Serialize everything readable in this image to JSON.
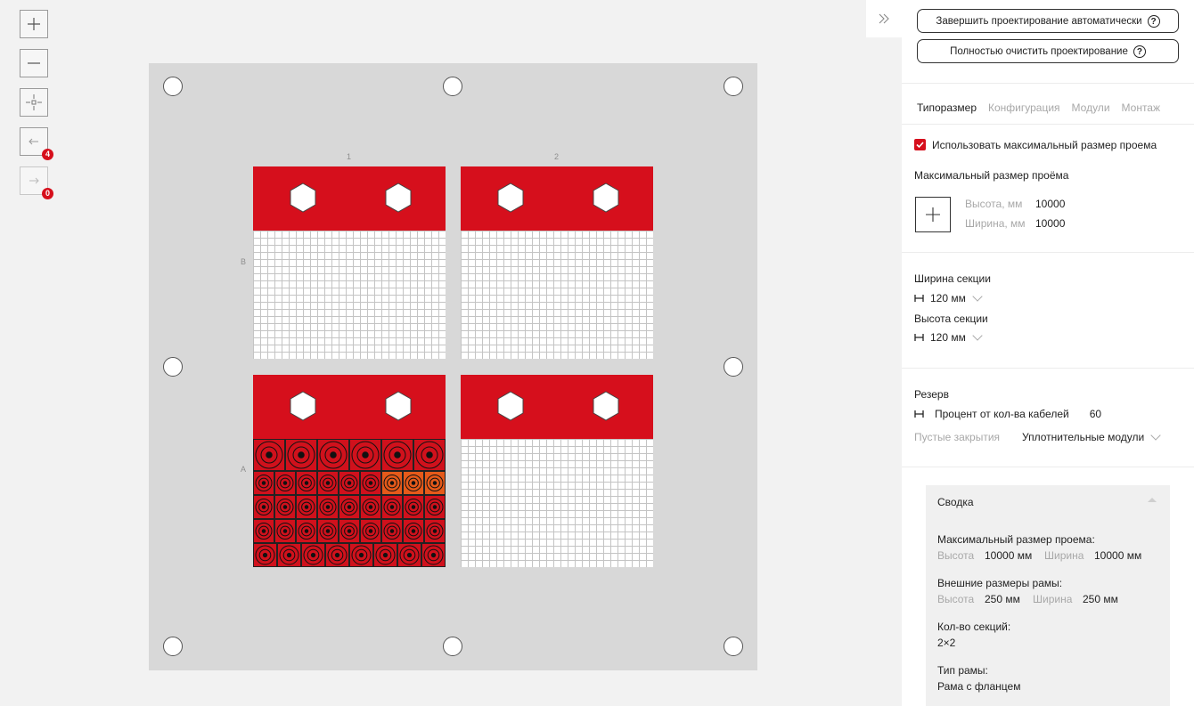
{
  "toolbar": {
    "undo_count": "4",
    "redo_count": "0"
  },
  "canvas": {
    "columns": [
      "1",
      "2"
    ],
    "rows": [
      "B",
      "A"
    ]
  },
  "sidebar": {
    "complete_auto_label": "Завершить проектирование автоматически",
    "clear_all_label": "Полностью очистить проектирование",
    "help_symbol": "?",
    "tabs": [
      "Типоразмер",
      "Конфигурация",
      "Модули",
      "Монтаж"
    ],
    "active_tab": "Типоразмер",
    "use_max_size_label": "Использовать максимальный размер проема",
    "use_max_size_checked": true,
    "max_opening_title": "Максимальный размер проёма",
    "height_label": "Высота, мм",
    "height_value": "10000",
    "width_label": "Ширина, мм",
    "width_value": "10000",
    "section_width_title": "Ширина секции",
    "section_width_value": "120 мм",
    "section_height_title": "Высота секции",
    "section_height_value": "120 мм",
    "reserve_title": "Резерв",
    "reserve_label": "Процент от кол-ва кабелей",
    "reserve_value": "60",
    "empty_closures_label": "Пустые закрытия",
    "empty_closures_value": "Уплотнительные модули"
  },
  "summary": {
    "title": "Сводка",
    "max_opening_label": "Максимальный размер проема:",
    "height_key": "Высота",
    "max_height_value": "10000 мм",
    "width_key": "Ширина",
    "max_width_value": "10000 мм",
    "frame_outer_label": "Внешние размеры рамы:",
    "frame_height_value": "250 мм",
    "frame_width_value": "250 мм",
    "section_count_label": "Кол-во секций:",
    "section_count_value": "2×2",
    "frame_type_label": "Тип рамы:",
    "frame_type_value": "Рама с фланцем"
  },
  "colors": {
    "accent": "#d60f1c",
    "module_fill": "#d0111c",
    "module_selected": "#e65a1a",
    "canvas_bg": "#d8d8d8"
  },
  "icons": [
    "zoom-in-icon",
    "zoom-out-icon",
    "center-icon",
    "undo-icon",
    "redo-icon",
    "collapse-panel-icon",
    "help-icon",
    "checkmark-icon",
    "plus-icon",
    "dimension-icon",
    "chevron-down-icon",
    "chevron-up-icon"
  ]
}
